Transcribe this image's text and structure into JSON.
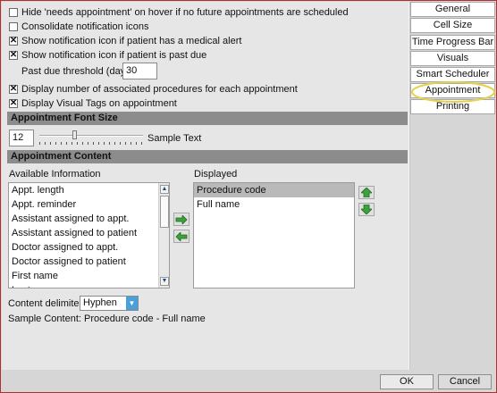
{
  "options": {
    "hide_needs_appt": {
      "label": "Hide 'needs appointment' on hover if no future appointments are scheduled",
      "checked": false
    },
    "consolidate": {
      "label": "Consolidate notification icons",
      "checked": false
    },
    "medical_alert": {
      "label": "Show notification icon if patient has a medical alert",
      "checked": true
    },
    "past_due": {
      "label": "Show notification icon if patient is past due",
      "checked": true
    },
    "past_due_threshold_label": "Past due threshold (days):",
    "past_due_threshold_value": "30",
    "display_procedures": {
      "label": "Display number of associated procedures for each appointment",
      "checked": true
    },
    "display_tags": {
      "label": "Display Visual Tags on appointment",
      "checked": true
    }
  },
  "font_size": {
    "header": "Appointment Font Size",
    "value": "12",
    "sample_text": "Sample Text",
    "slider_level_fraction": 0.33
  },
  "content": {
    "header": "Appointment Content",
    "available_label": "Available Information",
    "available_items": [
      "Appt. length",
      "Appt. reminder",
      "Assistant assigned to appt.",
      "Assistant assigned to patient",
      "Doctor assigned to appt.",
      "Doctor assigned to patient",
      "First name",
      "Last name"
    ],
    "displayed_label": "Displayed",
    "displayed_items": [
      "Procedure code",
      "Full name"
    ],
    "delimiter_label": "Content delimiter:",
    "delimiter_value": "Hyphen",
    "sample_content": "Sample Content: Procedure code - Full name"
  },
  "tabs": [
    "General",
    "Cell Size",
    "Time Progress Bar",
    "Visuals",
    "Smart Scheduler",
    "Appointment",
    "Printing"
  ],
  "selected_tab": "Appointment",
  "buttons": {
    "ok": "OK",
    "cancel": "Cancel"
  },
  "colors": {
    "section_header": "#8c8c8c",
    "selected_item": "#b9b9b9",
    "arrow_green": "#3fa03f",
    "highlight_circle": "#e6d24a"
  }
}
